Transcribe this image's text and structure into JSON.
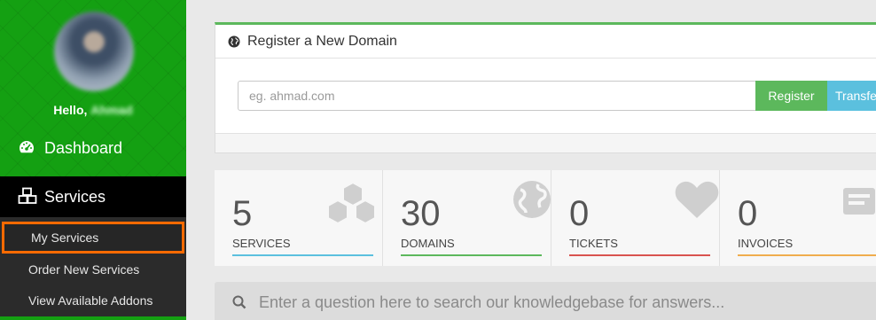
{
  "sidebar": {
    "greeting": "Hello,",
    "user_name": "Ahmad",
    "nav": {
      "dashboard": "Dashboard",
      "services": "Services"
    },
    "services_submenu": {
      "my_services": "My Services",
      "order_new": "Order New Services",
      "addons": "View Available Addons"
    }
  },
  "domain_panel": {
    "title": "Register a New Domain",
    "input_placeholder": "eg. ahmad.com",
    "register_label": "Register",
    "transfer_label": "Transfer"
  },
  "stats": [
    {
      "value": "5",
      "label": "SERVICES",
      "icon": "cubes-icon",
      "color": "#5bc0de"
    },
    {
      "value": "30",
      "label": "DOMAINS",
      "icon": "globe-icon",
      "color": "#5cb85c"
    },
    {
      "value": "0",
      "label": "TICKETS",
      "icon": "heart-icon",
      "color": "#d9534f"
    },
    {
      "value": "0",
      "label": "INVOICES",
      "icon": "invoice-icon",
      "color": "#f0ad4e"
    }
  ],
  "kb_search": {
    "placeholder": "Enter a question here to search our knowledgebase for answers..."
  },
  "colors": {
    "brand_green": "#14a012",
    "highlight_orange": "#ff6a00"
  }
}
